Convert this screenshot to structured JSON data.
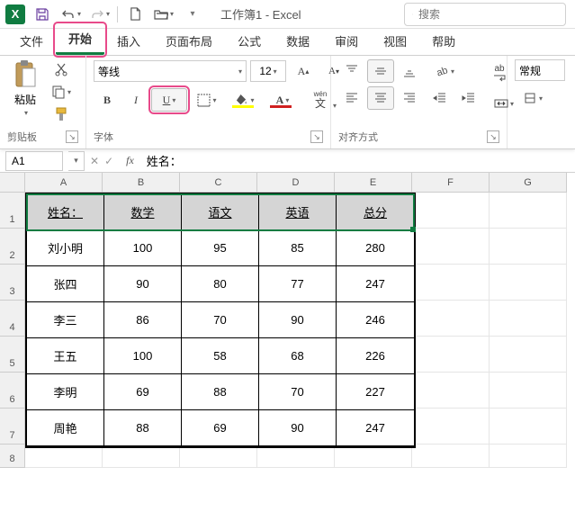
{
  "title": "工作簿1 - Excel",
  "search": {
    "placeholder": "搜索"
  },
  "tabs": [
    "文件",
    "开始",
    "插入",
    "页面布局",
    "公式",
    "数据",
    "审阅",
    "视图",
    "帮助"
  ],
  "active_tab": 1,
  "ribbon": {
    "clipboard": {
      "label": "剪贴板",
      "paste": "粘贴"
    },
    "font": {
      "label": "字体",
      "name": "等线",
      "size": "12",
      "bold": "B",
      "italic": "I",
      "underline": "U",
      "wen": "wén",
      "wen2": "文"
    },
    "align": {
      "label": "对齐方式",
      "wrap": "ab"
    },
    "number": {
      "label": "常规"
    }
  },
  "formula_bar": {
    "ref": "A1",
    "value": "姓名："
  },
  "columns": [
    "A",
    "B",
    "C",
    "D",
    "E",
    "F",
    "G"
  ],
  "rows": [
    "1",
    "2",
    "3",
    "4",
    "5",
    "6",
    "7",
    "8"
  ],
  "chart_data": {
    "type": "table",
    "headers": [
      "姓名：",
      "数学",
      "语文",
      "英语",
      "总分"
    ],
    "rows": [
      [
        "刘小明",
        "100",
        "95",
        "85",
        "280"
      ],
      [
        "张四",
        "90",
        "80",
        "77",
        "247"
      ],
      [
        "李三",
        "86",
        "70",
        "90",
        "246"
      ],
      [
        "王五",
        "100",
        "58",
        "68",
        "226"
      ],
      [
        "李明",
        "69",
        "88",
        "70",
        "227"
      ],
      [
        "周艳",
        "88",
        "69",
        "90",
        "247"
      ]
    ]
  }
}
